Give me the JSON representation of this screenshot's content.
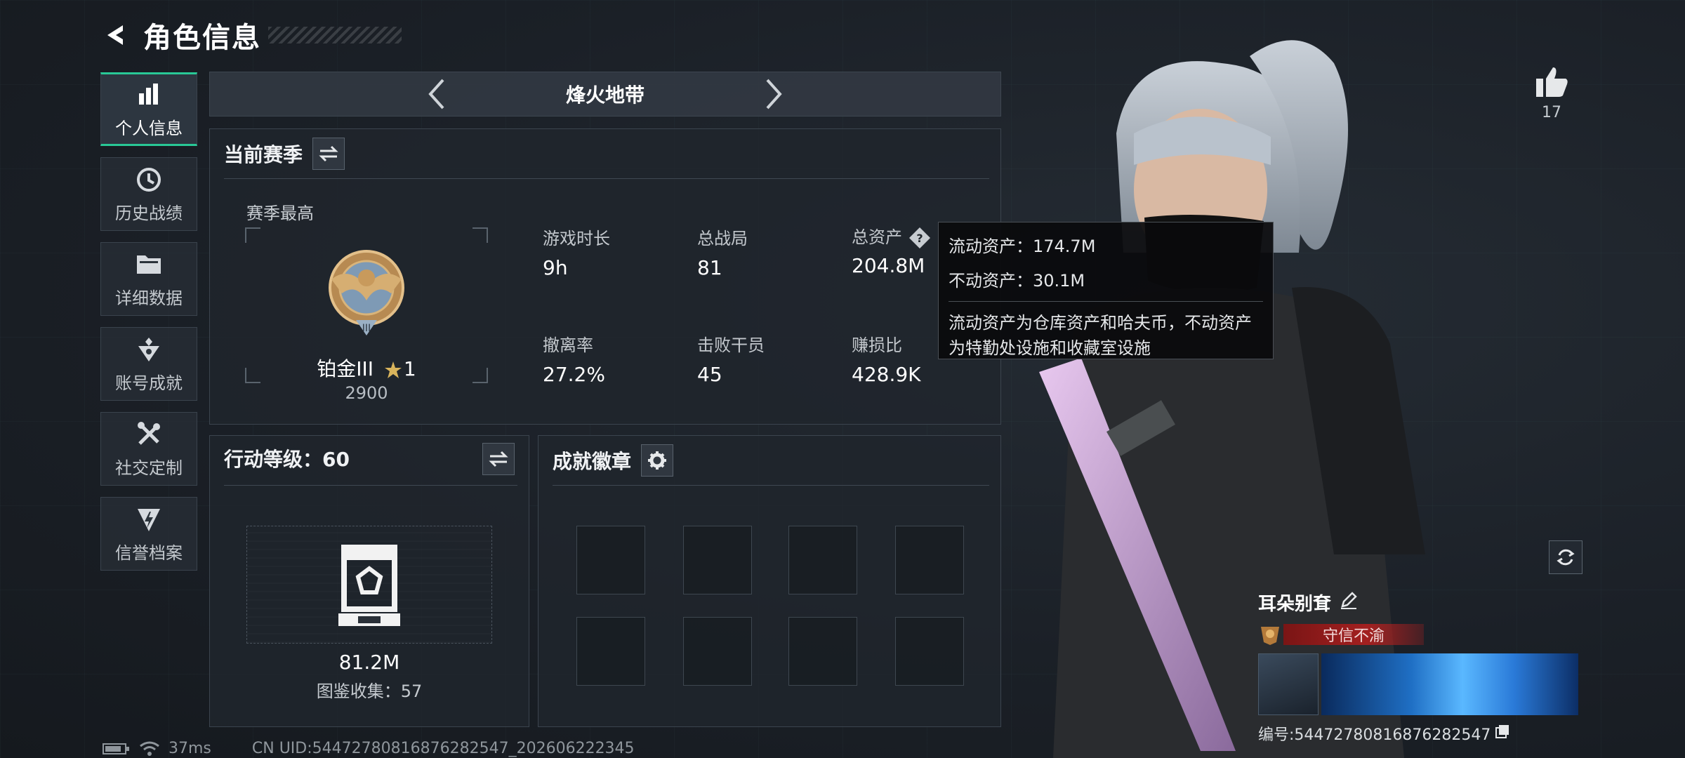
{
  "header": {
    "title": "角色信息"
  },
  "sidebar": {
    "items": [
      {
        "label": "个人信息",
        "icon": "bar-chart-icon",
        "active": true
      },
      {
        "label": "历史战绩",
        "icon": "history-icon"
      },
      {
        "label": "详细数据",
        "icon": "folder-icon"
      },
      {
        "label": "账号成就",
        "icon": "achievement-icon"
      },
      {
        "label": "社交定制",
        "icon": "tools-icon"
      },
      {
        "label": "信誉档案",
        "icon": "reputation-icon"
      }
    ]
  },
  "mode": {
    "title": "烽火地带"
  },
  "season": {
    "title": "当前赛季",
    "best_label": "赛季最高",
    "rank_name": "铂金III",
    "rank_stars": "1",
    "rank_score": "2900",
    "stats": {
      "play_time": {
        "label": "游戏时长",
        "value": "9h"
      },
      "total_matches": {
        "label": "总战局",
        "value": "81"
      },
      "total_assets": {
        "label": "总资产",
        "value": "204.8M"
      },
      "extract_rate": {
        "label": "撤离率",
        "value": "27.2%"
      },
      "kills": {
        "label": "击败干员",
        "value": "45"
      },
      "profit_ratio": {
        "label": "赚损比",
        "value": "428.9K"
      }
    }
  },
  "tooltip": {
    "liquid": "流动资产：174.7M",
    "fixed": "不动资产：30.1M",
    "desc": "流动资产为仓库资产和哈夫币，不动资产为特勤处设施和收藏室设施"
  },
  "level": {
    "title": "行动等级：60",
    "value": "81.2M",
    "collection": "图鉴收集：57"
  },
  "badges": {
    "title": "成就徽章"
  },
  "status": {
    "ping": "37ms",
    "uid": "CN UID:5447278081687628254​7_202606222345"
  },
  "like": {
    "count": "17"
  },
  "profile": {
    "name": "耳朵别耷",
    "title_tag": "守信不渝",
    "id_label": "编号:54472780816876282547"
  },
  "colors": {
    "accent": "#29c896",
    "title_red": "#a32020"
  }
}
